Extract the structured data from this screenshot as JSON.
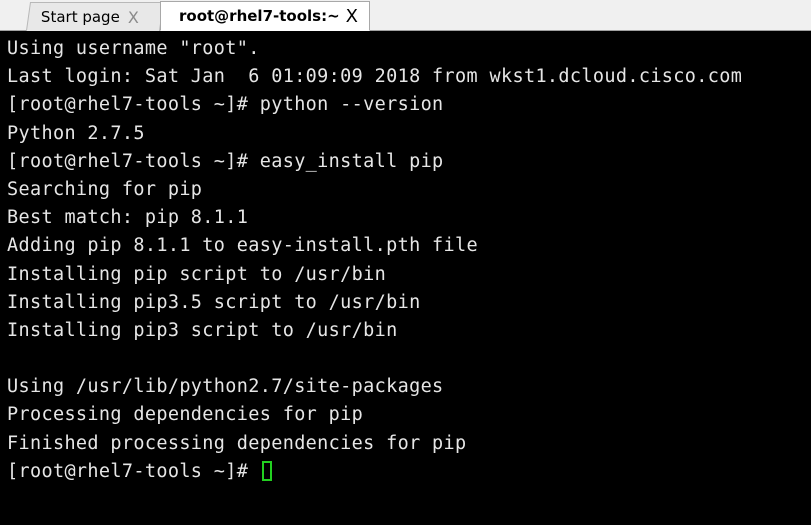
{
  "tabs": [
    {
      "label": "Start page",
      "close": "X",
      "active": false
    },
    {
      "label": "root@rhel7-tools:~",
      "close": "X",
      "active": true
    }
  ],
  "terminal": {
    "lines": [
      "Using username \"root\".",
      "Last login: Sat Jan  6 01:09:09 2018 from wkst1.dcloud.cisco.com",
      "[root@rhel7-tools ~]# python --version",
      "Python 2.7.5",
      "[root@rhel7-tools ~]# easy_install pip",
      "Searching for pip",
      "Best match: pip 8.1.1",
      "Adding pip 8.1.1 to easy-install.pth file",
      "Installing pip script to /usr/bin",
      "Installing pip3.5 script to /usr/bin",
      "Installing pip3 script to /usr/bin",
      "",
      "Using /usr/lib/python2.7/site-packages",
      "Processing dependencies for pip",
      "Finished processing dependencies for pip"
    ],
    "prompt": "[root@rhel7-tools ~]# ",
    "cursor_color": "#22d020",
    "text_color": "#e6e6e6",
    "background_color": "#000000"
  }
}
